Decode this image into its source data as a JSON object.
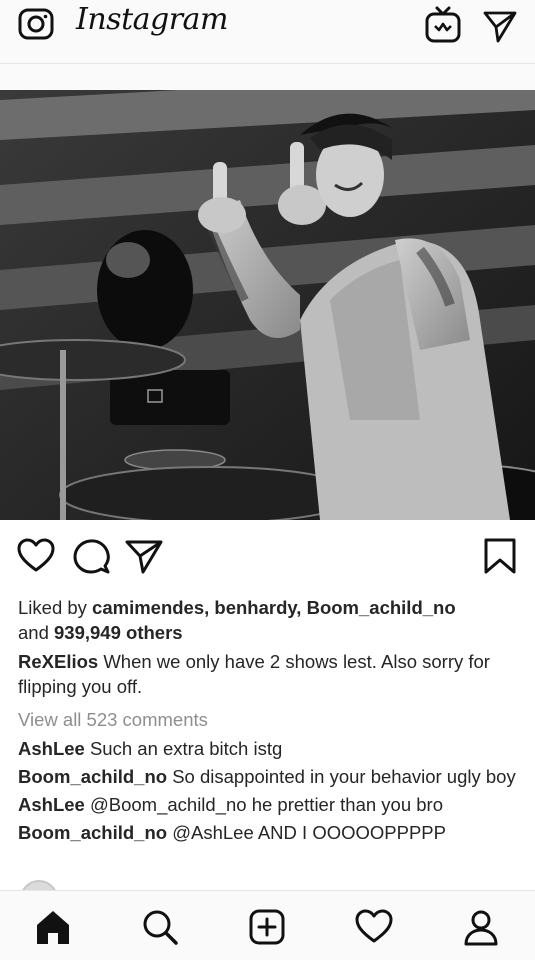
{
  "header": {
    "logo": "Instagram",
    "icons": [
      "camera-icon",
      "igtv-icon",
      "direct-message-icon"
    ]
  },
  "post": {
    "photo_alt": "",
    "actions": [
      "like-icon",
      "comment-icon",
      "share-icon",
      "save-bookmark-icon"
    ],
    "likes": {
      "prefix": "Liked by ",
      "users": "camimendes, benhardy, Boom_achild_no",
      "and": "and ",
      "others": "939,949 others"
    },
    "caption": {
      "user": "ReXElios",
      "text": "When we only have 2 shows lest. Also sorry for flipping you off."
    },
    "view_all_comments": "View all 523 comments",
    "comments": [
      {
        "user": "AshLee",
        "text": "Such an extra bitch istg"
      },
      {
        "user": "Boom_achild_no",
        "text": "So disappointed in your behavior ugly boy"
      },
      {
        "user": "AshLee",
        "text": "@Boom_achild_no he prettier than you bro"
      },
      {
        "user": "Boom_achild_no",
        "text": "@AshLee AND I OOOOOPPPPP"
      }
    ]
  },
  "bottom_nav": [
    "home-icon",
    "search-icon",
    "new-post-icon",
    "activity-heart-icon",
    "profile-icon"
  ]
}
